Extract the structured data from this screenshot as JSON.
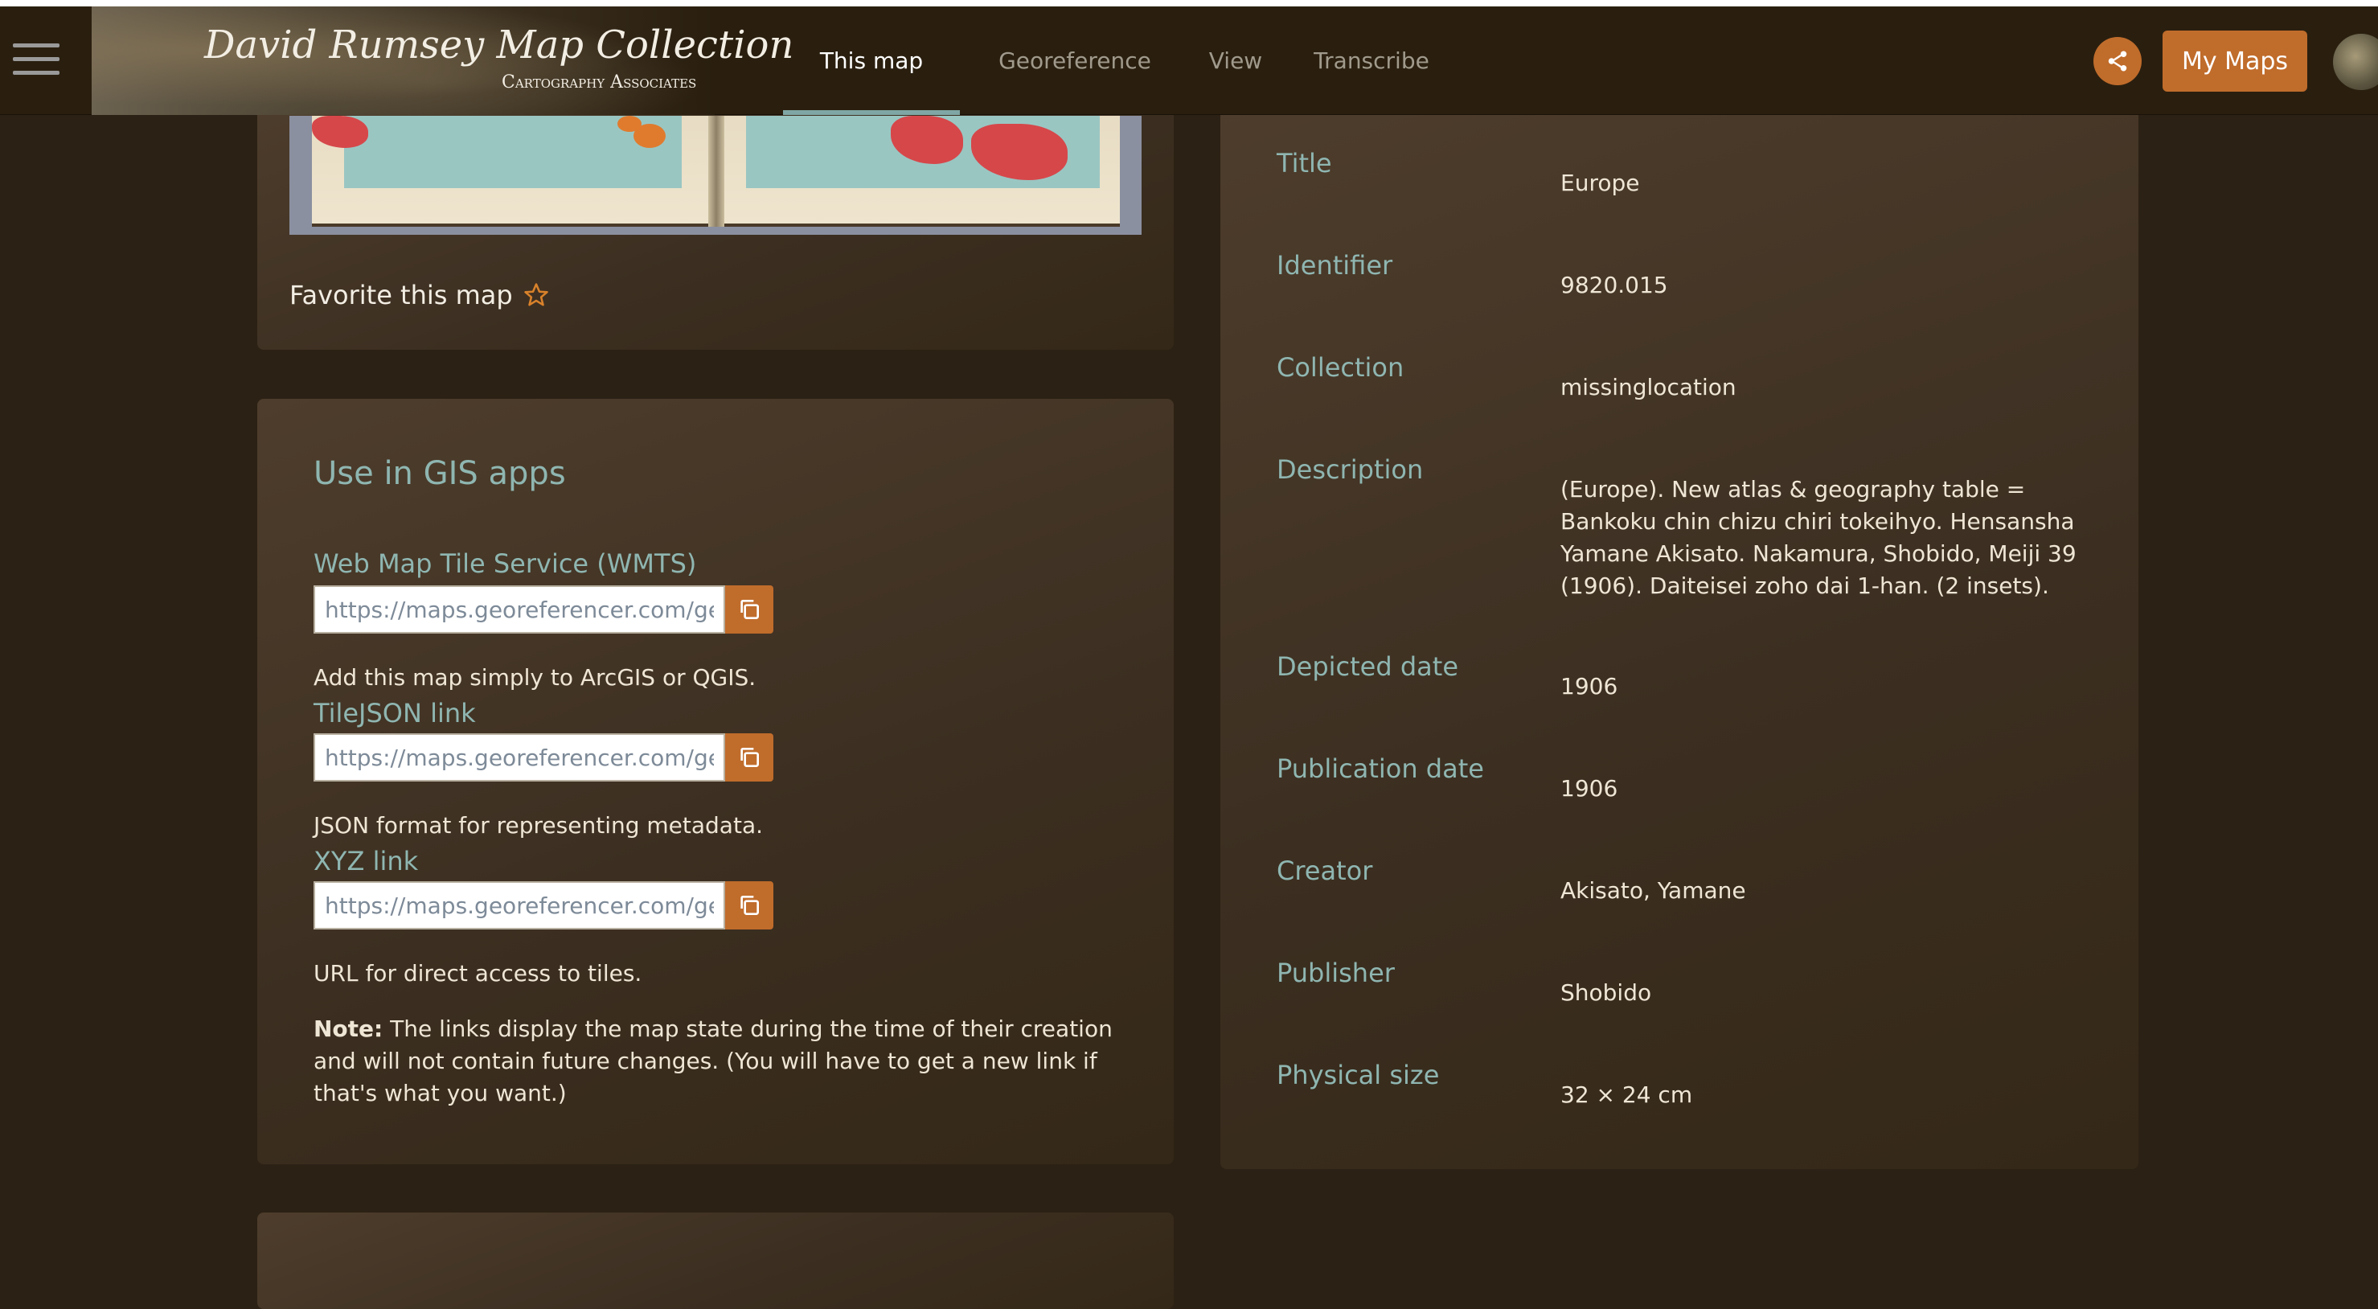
{
  "header": {
    "brand_title": "David Rumsey Map Collection",
    "brand_subtitle": "Cartography Associates",
    "tabs": [
      {
        "label": "This map",
        "active": true
      },
      {
        "label": "Georeference",
        "active": false
      },
      {
        "label": "View",
        "active": false
      },
      {
        "label": "Transcribe",
        "active": false
      }
    ],
    "my_maps_label": "My Maps",
    "accent_color": "#c06c2b",
    "active_tab_underline_color": "#7fa6a4"
  },
  "favorite": {
    "label": "Favorite this map",
    "icon": "star-outline-icon"
  },
  "gis": {
    "title": "Use in GIS apps",
    "links": [
      {
        "label": "Web Map Tile Service (WMTS)",
        "url": "https://maps.georeferencer.com/geor",
        "description": "Add this map simply to ArcGIS or QGIS."
      },
      {
        "label": "TileJSON link",
        "url": "https://maps.georeferencer.com/geor",
        "description": "JSON format for representing metadata."
      },
      {
        "label": "XYZ link",
        "url": "https://maps.georeferencer.com/geor",
        "description": "URL for direct access to tiles."
      }
    ],
    "note_bold": "Note:",
    "note_text": " The links display the map state during the time of their creation and will not contain future changes. (You will have to get a new link if that's what you want.)"
  },
  "metadata": [
    {
      "label": "Title",
      "value": "Europe"
    },
    {
      "label": "Identifier",
      "value": "9820.015"
    },
    {
      "label": "Collection",
      "value": "missinglocation"
    },
    {
      "label": "Description",
      "value": "(Europe). New atlas & geography table = Bankoku chin chizu chiri tokeihyo. Hensansha Yamane Akisato. Nakamura, Shobido, Meiji 39 (1906). Daiteisei zoho dai 1-han. (2 insets)."
    },
    {
      "label": "Depicted date",
      "value": "1906"
    },
    {
      "label": "Publication date",
      "value": "1906"
    },
    {
      "label": "Creator",
      "value": "Akisato, Yamane"
    },
    {
      "label": "Publisher",
      "value": "Shobido"
    },
    {
      "label": "Physical size",
      "value": "32 × 24 cm"
    }
  ]
}
